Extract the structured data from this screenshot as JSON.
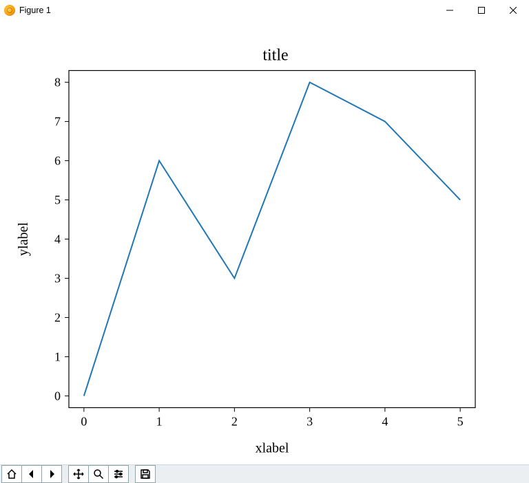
{
  "window": {
    "title": "Figure 1"
  },
  "toolbar": {
    "home": "Home",
    "back": "Back",
    "forward": "Forward",
    "pan": "Pan",
    "zoom": "Zoom",
    "configure": "Configure subplots",
    "save": "Save"
  },
  "chart_data": {
    "type": "line",
    "title": "title",
    "xlabel": "xlabel",
    "ylabel": "ylabel",
    "x": [
      0,
      1,
      2,
      3,
      4,
      5
    ],
    "y": [
      0,
      6,
      3,
      8,
      7,
      5
    ],
    "xticks": [
      0,
      1,
      2,
      3,
      4,
      5
    ],
    "yticks": [
      0,
      1,
      2,
      3,
      4,
      5,
      6,
      7,
      8
    ],
    "xlim": [
      -0.2,
      5.2
    ],
    "ylim": [
      -0.3,
      8.3
    ],
    "line_color": "#1f77b4"
  }
}
